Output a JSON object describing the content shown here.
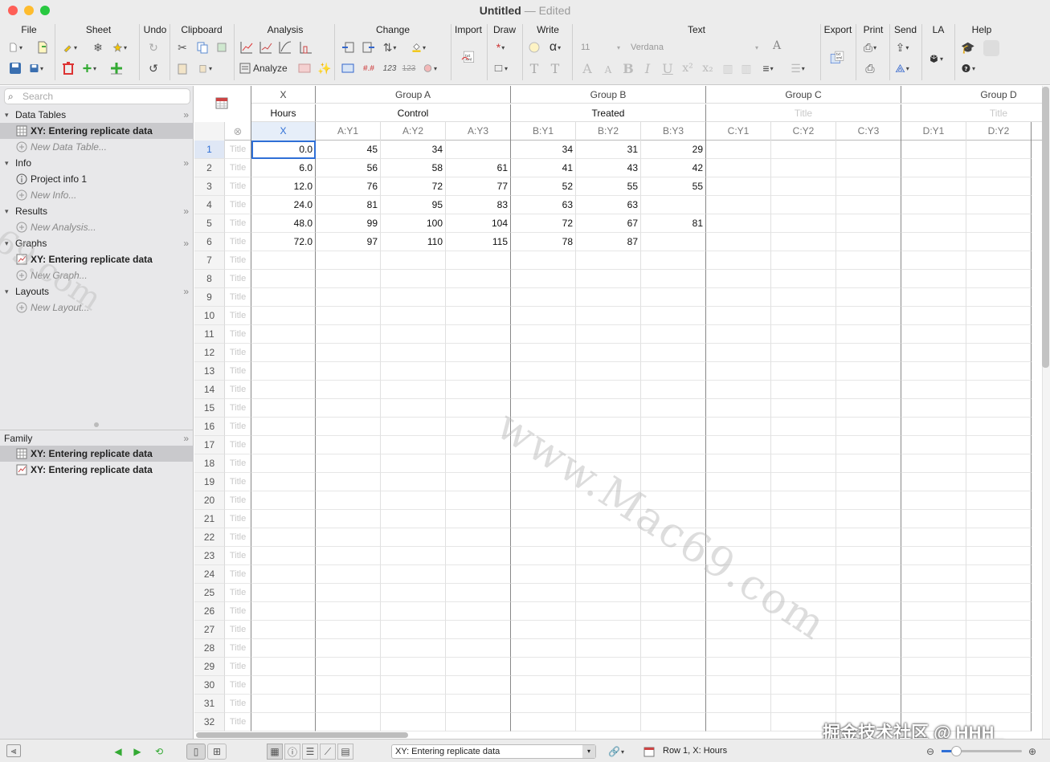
{
  "window": {
    "title": "Untitled",
    "edited": "Edited",
    "dash": "—"
  },
  "toolbar": {
    "groups": [
      "File",
      "Sheet",
      "Undo",
      "Clipboard",
      "Analysis",
      "Change",
      "Import",
      "Draw",
      "Write",
      "Text",
      "Export",
      "Print",
      "Send",
      "LA",
      "Help"
    ],
    "analyze_label": "Analyze",
    "font_size": "11",
    "font_name": "Verdana"
  },
  "navigator": {
    "search_placeholder": "Search",
    "data_tables": {
      "label": "Data Tables",
      "items": [
        "XY: Entering replicate data"
      ],
      "new": "New Data Table..."
    },
    "info": {
      "label": "Info",
      "items": [
        "Project info 1"
      ],
      "new": "New Info..."
    },
    "results": {
      "label": "Results",
      "new": "New Analysis..."
    },
    "graphs": {
      "label": "Graphs",
      "items": [
        "XY: Entering replicate data"
      ],
      "new": "New Graph..."
    },
    "layouts": {
      "label": "Layouts",
      "new": "New Layout..."
    },
    "family": {
      "label": "Family",
      "items": [
        "XY: Entering replicate data",
        "XY: Entering replicate data"
      ]
    }
  },
  "table": {
    "x_header": {
      "group": "X",
      "title": "Hours",
      "col": "X"
    },
    "groups": [
      {
        "name": "Group A",
        "title": "Control",
        "cols": [
          "A:Y1",
          "A:Y2",
          "A:Y3"
        ]
      },
      {
        "name": "Group B",
        "title": "Treated",
        "cols": [
          "B:Y1",
          "B:Y2",
          "B:Y3"
        ]
      },
      {
        "name": "Group C",
        "title": "Title",
        "cols": [
          "C:Y1",
          "C:Y2",
          "C:Y3"
        ]
      },
      {
        "name": "Group D",
        "title": "Title",
        "cols": [
          "D:Y1",
          "D:Y2"
        ]
      }
    ],
    "row_title_placeholder": "Title",
    "row_count": 32,
    "x_values": [
      "0.0",
      "6.0",
      "12.0",
      "24.0",
      "48.0",
      "72.0"
    ],
    "rows": [
      [
        "45",
        "34",
        "",
        "34",
        "31",
        "29"
      ],
      [
        "56",
        "58",
        "61",
        "41",
        "43",
        "42"
      ],
      [
        "76",
        "72",
        "77",
        "52",
        "55",
        "55"
      ],
      [
        "81",
        "95",
        "83",
        "63",
        "63",
        ""
      ],
      [
        "99",
        "100",
        "104",
        "72",
        "67",
        "81"
      ],
      [
        "97",
        "110",
        "115",
        "78",
        "87",
        ""
      ]
    ]
  },
  "statusbar": {
    "sheet_selector": "XY: Entering replicate data",
    "status": "Row 1, X: Hours"
  },
  "overlay": {
    "watermark": "www.Mac69.com",
    "watermark_left": "69.com",
    "credit": "掘金技术社区 @ HHH_"
  },
  "colors": {
    "accent": "#2f6fd6",
    "selected_nav": "#c9c9cc"
  }
}
